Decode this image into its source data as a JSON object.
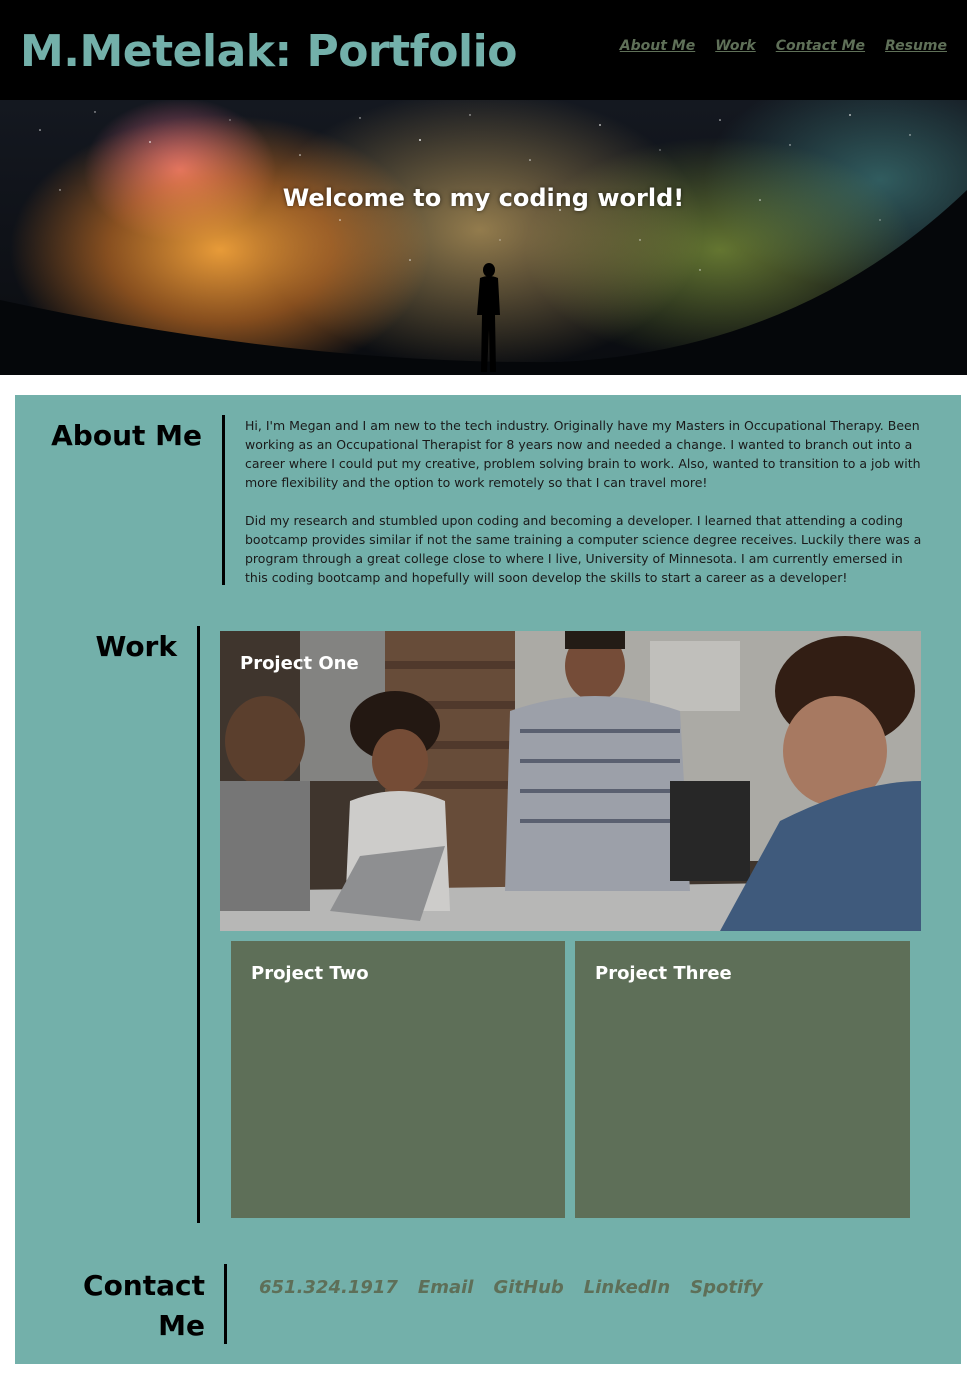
{
  "header": {
    "title": "M.Metelak: Portfolio",
    "nav": [
      "About Me",
      "Work",
      "Contact Me",
      "Resume"
    ]
  },
  "hero": {
    "text": "Welcome to my coding world!"
  },
  "about": {
    "heading": "About Me",
    "paragraphs": [
      "Hi, I'm Megan and I am new to the tech industry. Originally have my Masters in Occupational Therapy. Been working as an Occupational Therapist for 8 years now and needed a change. I wanted to branch out into a career where I could put my creative, problem solving brain to work. Also, wanted to transition to a job with more flexibility and the option to work remotely so that I can travel more!",
      "Did my research and stumbled upon coding and becoming a developer. I learned that attending a coding bootcamp provides similar if not the same training a computer science degree receives. Luckily there was a program through a great college close to where I live, University of Minnesota. I am currently emersed in this coding bootcamp and hopefully will soon develop the skills to start a career as a developer!"
    ]
  },
  "work": {
    "heading": "Work",
    "projects": [
      "Project One",
      "Project Two",
      "Project Three"
    ]
  },
  "contact": {
    "heading_line1": "Contact",
    "heading_line2": "Me",
    "links": [
      "651.324.1917",
      "Email",
      "GitHub",
      "LinkedIn",
      "Spotify"
    ]
  },
  "colors": {
    "accent": "#73b0aa",
    "header_bg": "#000000",
    "card": "#5e6f58"
  }
}
